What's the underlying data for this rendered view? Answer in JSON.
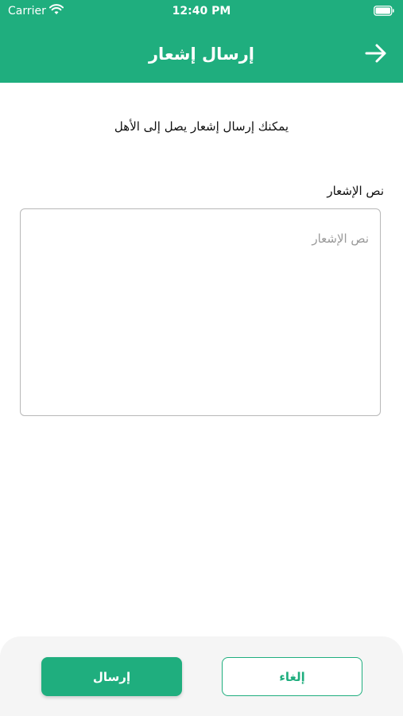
{
  "status_bar": {
    "carrier": "Carrier",
    "time": "12:40 PM",
    "wifi_icon": "wifi-icon",
    "battery_icon": "battery-icon"
  },
  "header": {
    "title": "إرسال إشعار",
    "back_icon": "arrow-right-icon",
    "background_color": "#1fae7e"
  },
  "main": {
    "description": "يمكنك إرسال إشعار يصل إلى الأهل",
    "field_label": "نص الإشعار",
    "textarea_value": "",
    "textarea_placeholder": "نص الإشعار"
  },
  "footer": {
    "send_label": "إرسال",
    "cancel_label": "إلغاء",
    "accent_color": "#1fae7e"
  }
}
